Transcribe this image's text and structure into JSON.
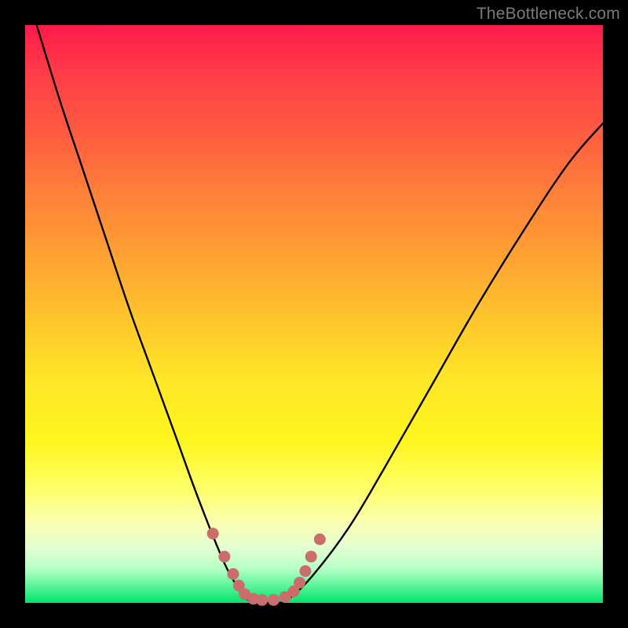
{
  "watermark": {
    "text": "TheBottleneck.com"
  },
  "chart_data": {
    "type": "line",
    "title": "",
    "xlabel": "",
    "ylabel": "",
    "xlim": [
      0,
      100
    ],
    "ylim": [
      0,
      100
    ],
    "series": [
      {
        "name": "bottleneck-curve",
        "x": [
          2,
          6,
          10,
          14,
          18,
          22,
          26,
          30,
          34,
          36,
          38,
          40,
          42,
          44,
          46,
          50,
          56,
          62,
          70,
          78,
          86,
          94,
          100
        ],
        "y": [
          100,
          87,
          75,
          63,
          51,
          40,
          29,
          18,
          8,
          4,
          1,
          0,
          0,
          0,
          1,
          5,
          13,
          23,
          37,
          51,
          64,
          76,
          83
        ]
      }
    ],
    "markers": {
      "name": "highlight-dots",
      "color": "#cc6d6d",
      "x": [
        32.5,
        34.5,
        36,
        37,
        38,
        39.5,
        41,
        43,
        45,
        46.5,
        47.5,
        48.5,
        49.5,
        51
      ],
      "y": [
        12,
        8,
        5,
        3,
        1.5,
        0.7,
        0.5,
        0.5,
        1,
        2,
        3.5,
        5.5,
        8,
        11
      ]
    }
  }
}
